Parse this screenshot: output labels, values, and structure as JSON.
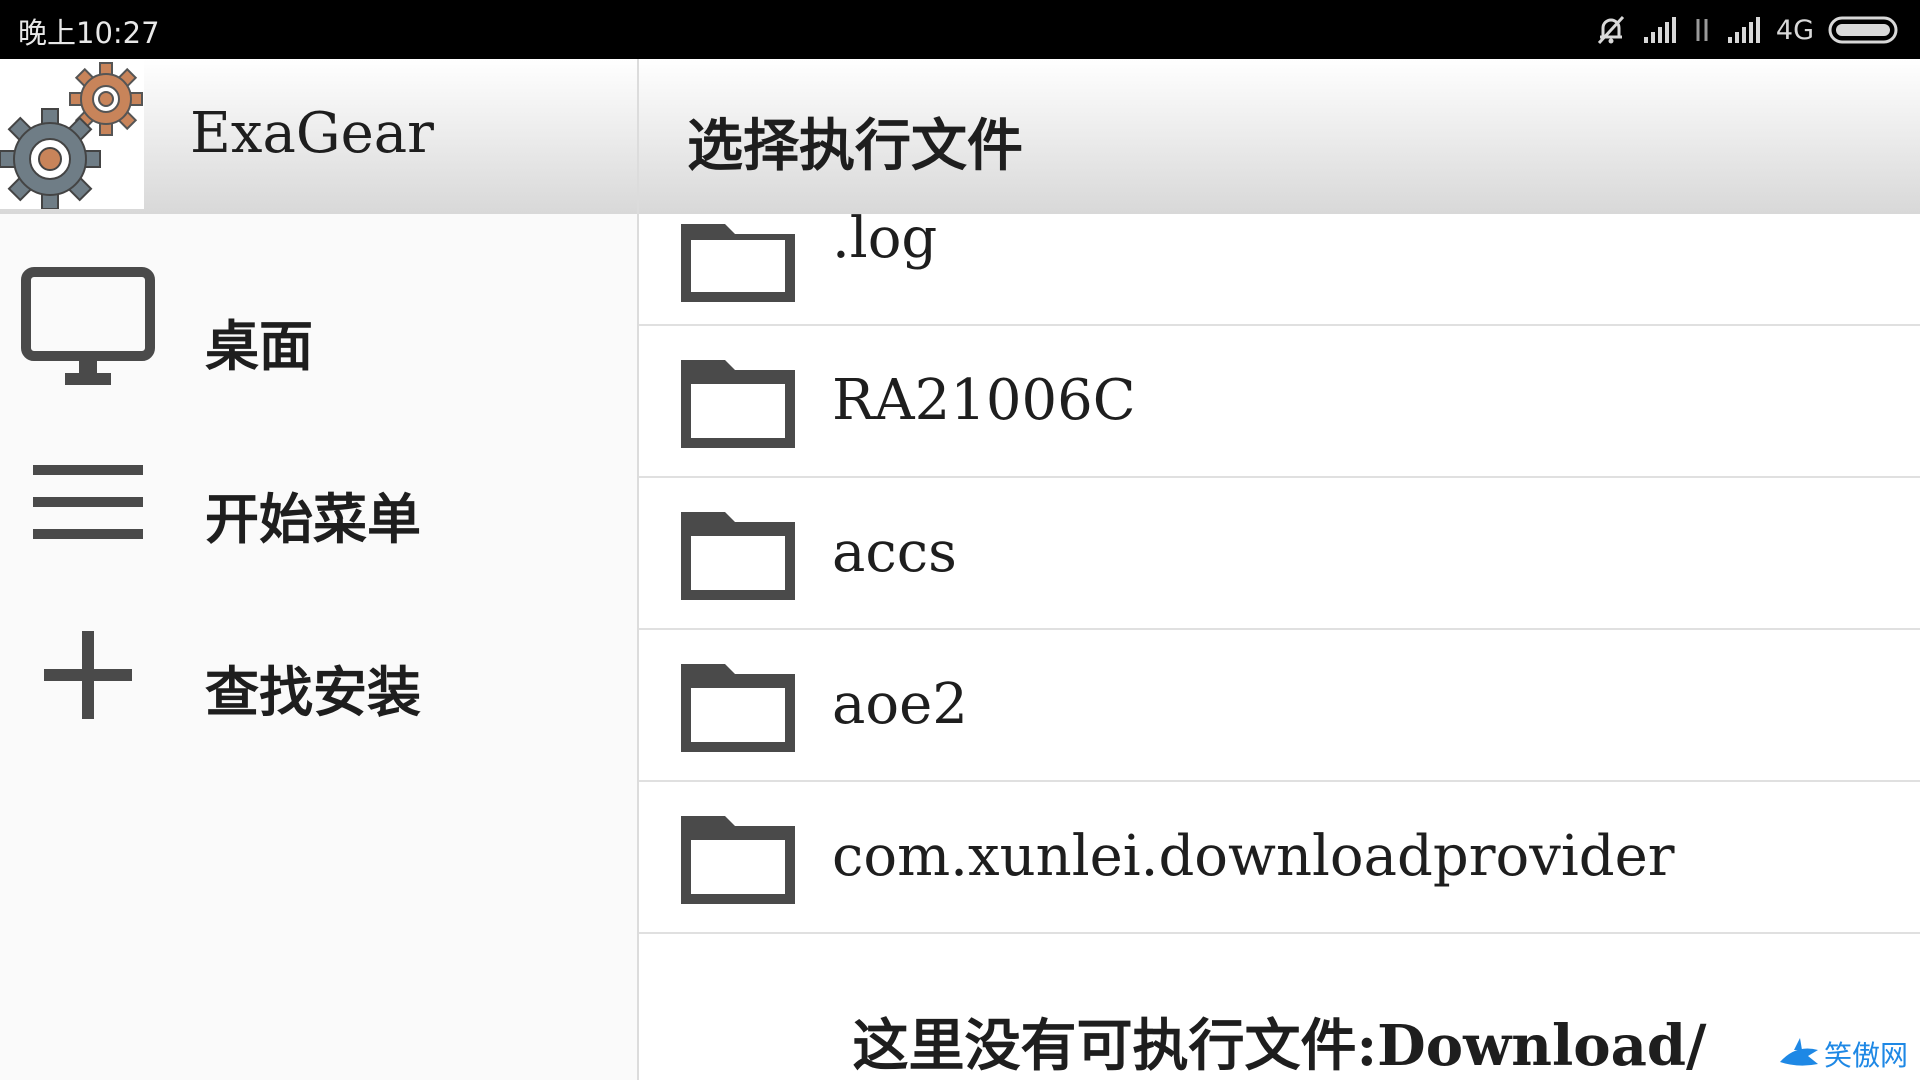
{
  "status_bar": {
    "time": "晚上10:27",
    "network": "4G",
    "icons": [
      "mute-icon",
      "signal-icon",
      "data-arrows-icon",
      "signal-icon",
      "battery-icon"
    ]
  },
  "drawer": {
    "app_name": "ExaGear",
    "logo_icon": "gears-icon",
    "items": [
      {
        "label": "桌面",
        "icon": "monitor-icon"
      },
      {
        "label": "开始菜单",
        "icon": "menu-icon"
      },
      {
        "label": "查找安装",
        "icon": "plus-icon"
      }
    ]
  },
  "panel": {
    "title": "选择执行文件",
    "files": [
      {
        "name": ".log",
        "icon": "folder-icon"
      },
      {
        "name": "RA21006C",
        "icon": "folder-icon"
      },
      {
        "name": "accs",
        "icon": "folder-icon"
      },
      {
        "name": "aoe2",
        "icon": "folder-icon"
      },
      {
        "name": "com.xunlei.downloadprovider",
        "icon": "folder-icon"
      }
    ],
    "empty_message": "这里没有可执行文件:Download/"
  },
  "watermark": {
    "text": "笑傲网"
  },
  "colors": {
    "status_bar_bg": "#000000",
    "drawer_bg": "#fafafa",
    "icon_color": "#4a4a4a",
    "gear_gray": "#6f7d86",
    "gear_orange": "#c8845a"
  }
}
